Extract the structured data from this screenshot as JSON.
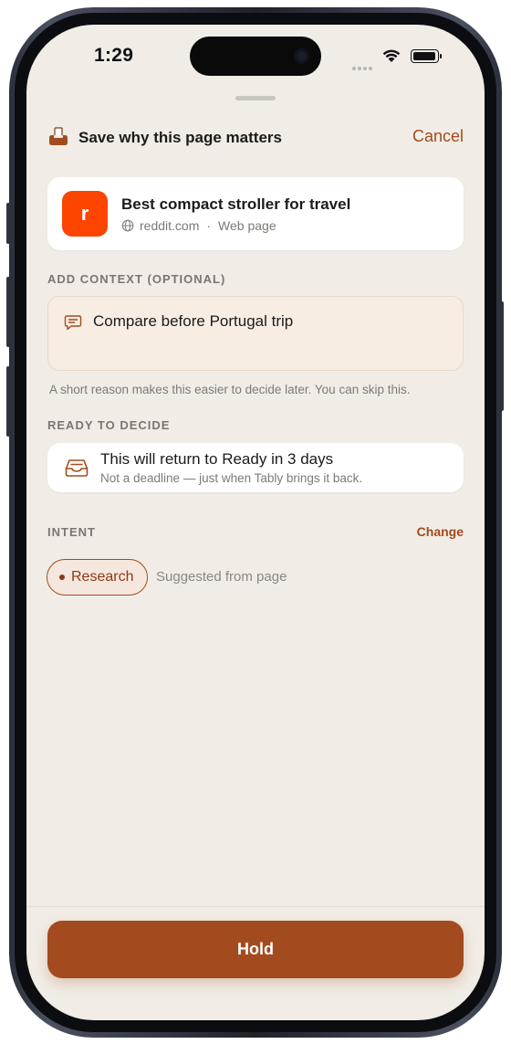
{
  "status_bar": {
    "time": "1:29"
  },
  "header": {
    "title": "Save why this page matters",
    "cancel_label": "Cancel",
    "icon": "tray-with-tab-icon"
  },
  "page": {
    "title": "Best compact stroller for travel",
    "site_letter": "r",
    "domain": "reddit.com",
    "type": "Web page",
    "separator": "·",
    "badge_color": "#fd4500"
  },
  "context": {
    "section_label": "ADD CONTEXT (OPTIONAL)",
    "value": "Compare before Portugal trip",
    "helper": "A short reason makes this easier to decide later. You can skip this."
  },
  "ready": {
    "section_label": "READY TO DECIDE",
    "title": "This will return to Ready in 3 days",
    "subtitle": "Not a deadline — just when Tably brings it back."
  },
  "intent": {
    "section_label": "INTENT",
    "change_label": "Change",
    "selected": "Research",
    "suggested_note": "Suggested from page"
  },
  "footer": {
    "hold_label": "Hold"
  },
  "colors": {
    "accent": "#a34b1e",
    "background": "#f1ede6",
    "card": "#ffffff"
  }
}
